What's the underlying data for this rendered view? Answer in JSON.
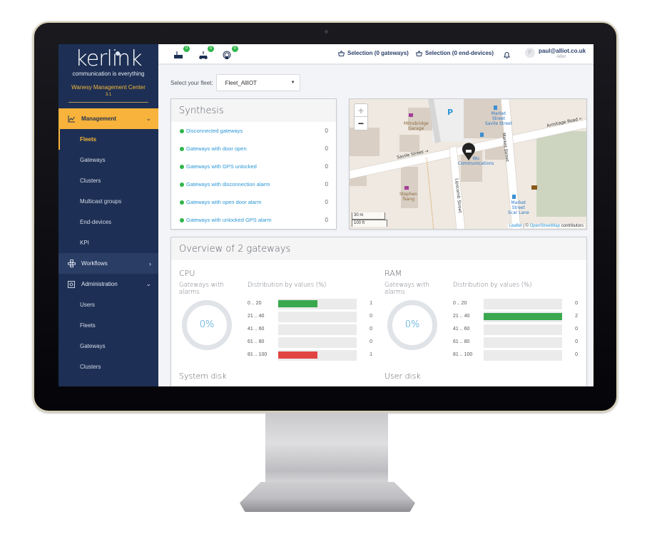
{
  "sidebar": {
    "logo": "kerlink",
    "tagline": "communication is everything",
    "app_name": "Wanesy Management Center",
    "version": "3.1",
    "groups": [
      {
        "label": "Management",
        "icon": "chart-line-icon",
        "expanded": true,
        "items": [
          {
            "label": "Fleets",
            "active": true
          },
          {
            "label": "Gateways"
          },
          {
            "label": "Clusters"
          },
          {
            "label": "Multicast groups"
          },
          {
            "label": "End-devices"
          },
          {
            "label": "KPI"
          }
        ]
      },
      {
        "label": "Workflows",
        "icon": "workflow-icon",
        "expanded": false,
        "items": []
      },
      {
        "label": "Administration",
        "icon": "admin-icon",
        "expanded": true,
        "items": [
          {
            "label": "Users"
          },
          {
            "label": "Fleets"
          },
          {
            "label": "Gateways"
          },
          {
            "label": "Clusters"
          }
        ]
      }
    ]
  },
  "topbar": {
    "status_icons": [
      {
        "icon": "gateway-icon",
        "count": "0"
      },
      {
        "icon": "end-device-icon",
        "count": "0"
      },
      {
        "icon": "antenna-icon",
        "count": "0"
      }
    ],
    "selection_gateways": "Selection (0 gateways)",
    "selection_devices": "Selection (0 end-devices)",
    "avatar_initial": "P",
    "user_email": "paul@alliot.co.uk",
    "user_org": "Alliot"
  },
  "fleet": {
    "label": "Select your fleet:",
    "selected": "Fleet_AllIOT"
  },
  "synthesis": {
    "title": "Synthesis",
    "rows": [
      {
        "label": "Disconnected gateways",
        "count": "0"
      },
      {
        "label": "Gateways with door open",
        "count": "0"
      },
      {
        "label": "Gateways with GPS unlocked",
        "count": "0"
      },
      {
        "label": "Gateways with disconnection alarm",
        "count": "0"
      },
      {
        "label": "Gateways with open door alarm",
        "count": "0"
      },
      {
        "label": "Gateways with unlocked GPS alarm",
        "count": "0"
      }
    ]
  },
  "map": {
    "zoom_in": "+",
    "zoom_out": "−",
    "scale_metric": "30 m",
    "scale_imperial": "100 ft",
    "attribution_leaflet": "Leaflet",
    "attribution_sep": " | © ",
    "attribution_osm": "OpenStreetMap",
    "attribution_suffix": " contributors",
    "labels": {
      "garage": "Milnsbridge\nGarage",
      "parking": "P",
      "bus_stop_1": "Market\nStreet\nSavile Street",
      "armitage": "Armitage Road ←",
      "savile": "Savile Street →",
      "market_street": "Market Street",
      "comms": "Wu\nCommunications",
      "stephen": "Stephen\nTsang",
      "lipscomb": "Lipscomb Street",
      "bus_stop_2": "Market\nStreet\nScar Lane"
    }
  },
  "overview": {
    "title": "Overview of 2 gateways",
    "alarm_label": "Gateways with alarms",
    "dist_label": "Distribution by values (%)",
    "colors": {
      "ok": "#3aa84f",
      "alarm": "#e24444"
    },
    "metrics": [
      {
        "name": "CPU",
        "alarm_pct": "0%",
        "buckets": [
          {
            "range": "0 .. 20",
            "count": "1",
            "fraction": 0.5,
            "status": "ok"
          },
          {
            "range": "21 .. 40",
            "count": "0",
            "fraction": 0,
            "status": "ok"
          },
          {
            "range": "41 .. 60",
            "count": "0",
            "fraction": 0,
            "status": "ok"
          },
          {
            "range": "61 .. 80",
            "count": "0",
            "fraction": 0,
            "status": "ok"
          },
          {
            "range": "81 .. 100",
            "count": "1",
            "fraction": 0.5,
            "status": "alarm"
          }
        ]
      },
      {
        "name": "RAM",
        "alarm_pct": "0%",
        "buckets": [
          {
            "range": "0 .. 20",
            "count": "0",
            "fraction": 0,
            "status": "ok"
          },
          {
            "range": "21 .. 40",
            "count": "2",
            "fraction": 1.0,
            "status": "ok"
          },
          {
            "range": "41 .. 60",
            "count": "0",
            "fraction": 0,
            "status": "ok"
          },
          {
            "range": "61 .. 80",
            "count": "0",
            "fraction": 0,
            "status": "ok"
          },
          {
            "range": "81 .. 100",
            "count": "0",
            "fraction": 0,
            "status": "ok"
          }
        ]
      }
    ],
    "next_metrics": [
      "System disk",
      "User disk"
    ]
  }
}
